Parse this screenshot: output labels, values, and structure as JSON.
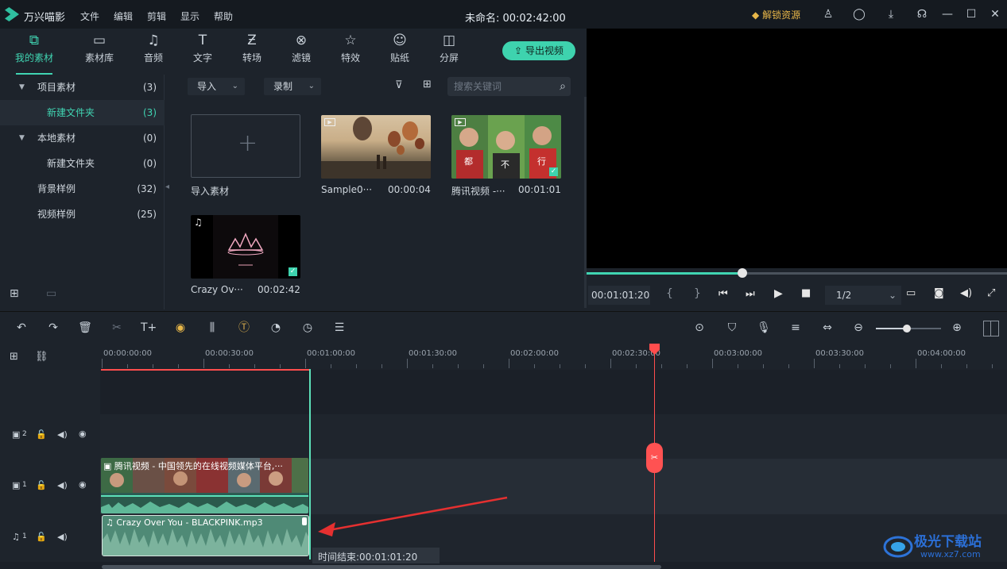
{
  "app": {
    "name": "万兴喵影",
    "doc_title": "未命名: 00:02:42:00",
    "unlock": "解锁资源"
  },
  "menu": [
    "文件",
    "编辑",
    "剪辑",
    "显示",
    "帮助"
  ],
  "tabs": [
    {
      "label": "我的素材",
      "icon": "folder-box-icon",
      "glyph": "⧉"
    },
    {
      "label": "素材库",
      "icon": "folder-icon",
      "glyph": "▭"
    },
    {
      "label": "音频",
      "icon": "music-note-icon",
      "glyph": "♫"
    },
    {
      "label": "文字",
      "icon": "text-icon",
      "glyph": "T"
    },
    {
      "label": "转场",
      "icon": "transition-icon",
      "glyph": "Ƶ"
    },
    {
      "label": "滤镜",
      "icon": "filter-icon",
      "glyph": "⊗"
    },
    {
      "label": "特效",
      "icon": "effects-star-icon",
      "glyph": "☆"
    },
    {
      "label": "贴纸",
      "icon": "sticker-face-icon",
      "glyph": "☺"
    },
    {
      "label": "分屏",
      "icon": "split-screen-icon",
      "glyph": "◫"
    }
  ],
  "export_label": "导出视频",
  "sidebar": [
    {
      "name": "项目素材",
      "count": "(3)",
      "expand": "▼"
    },
    {
      "name": "新建文件夹",
      "count": "(3)",
      "expand": ""
    },
    {
      "name": "本地素材",
      "count": "(0)",
      "expand": "▼"
    },
    {
      "name": "新建文件夹",
      "count": "(0)",
      "expand": ""
    },
    {
      "name": "背景样例",
      "count": "(32)",
      "expand": ""
    },
    {
      "name": "视频样例",
      "count": "(25)",
      "expand": ""
    }
  ],
  "media_toolbar": {
    "import": "导入",
    "record": "录制",
    "search_placeholder": "搜索关键词"
  },
  "media_items": [
    {
      "name": "导入素材",
      "time": ""
    },
    {
      "name": "Sample0···",
      "time": "00:00:04"
    },
    {
      "name": "腾讯视频 -···",
      "time": "00:01:01"
    },
    {
      "name": "Crazy Ov···",
      "time": "00:02:42"
    }
  ],
  "preview": {
    "timecode": "00:01:01:20",
    "zoom": "1/2",
    "brace_open": "{",
    "brace_close": "}",
    "progress": 0.37
  },
  "ruler_labels": [
    "00:00:00:00",
    "00:00:30:00",
    "00:01:00:00",
    "00:01:30:00",
    "00:02:00:00",
    "00:02:30:00",
    "00:03:00:00",
    "00:03:30:00",
    "00:04:00:00"
  ],
  "tracks": {
    "v2": "2",
    "v1": "1",
    "a1": "1"
  },
  "clips": {
    "video_title": "腾讯视频 - 中国领先的在线视频媒体平台,···",
    "audio_title": "Crazy Over You - BLACKPINK.mp3"
  },
  "tooltip": "时间结束:00:01:01:20",
  "watermark": {
    "cn": "极光下载站",
    "url": "www.xz7.com"
  },
  "colors": {
    "accent": "#40d4b2",
    "playhead": "#ff4d4d",
    "arrow": "#e53030",
    "unlock": "#e8b749"
  }
}
